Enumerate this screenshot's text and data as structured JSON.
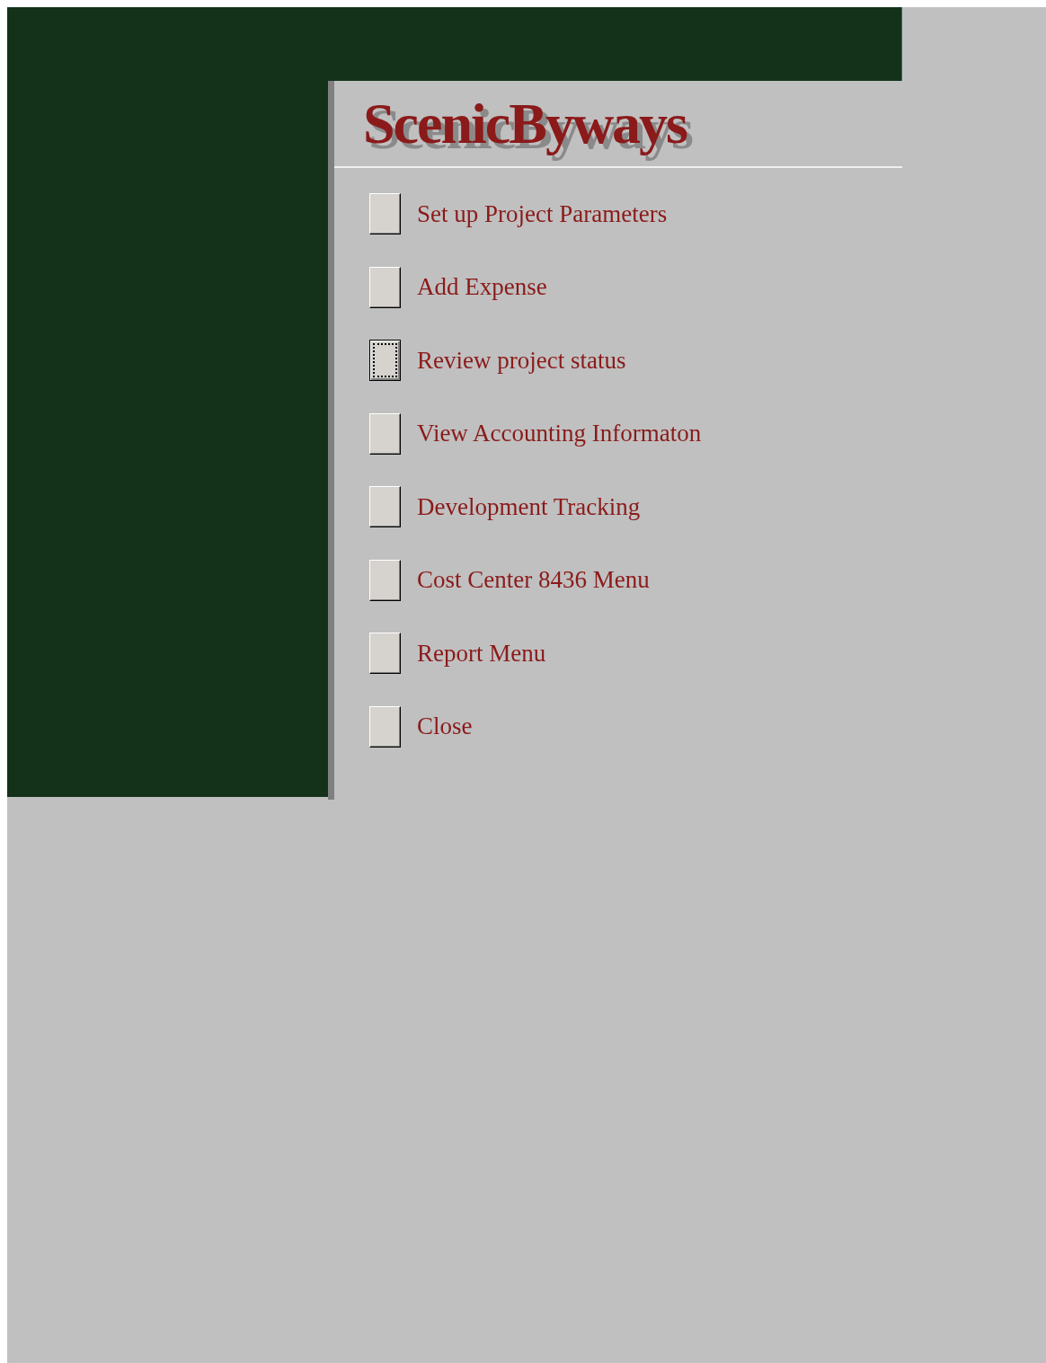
{
  "title": "ScenicByways",
  "items": [
    {
      "label": "Set up Project Parameters",
      "selected": false
    },
    {
      "label": "Add Expense",
      "selected": false
    },
    {
      "label": "Review project status",
      "selected": true
    },
    {
      "label": "View Accounting Informaton",
      "selected": false
    },
    {
      "label": "Development Tracking",
      "selected": false
    },
    {
      "label": "Cost Center 8436 Menu",
      "selected": false
    },
    {
      "label": "Report Menu",
      "selected": false
    },
    {
      "label": "Close",
      "selected": false
    }
  ]
}
